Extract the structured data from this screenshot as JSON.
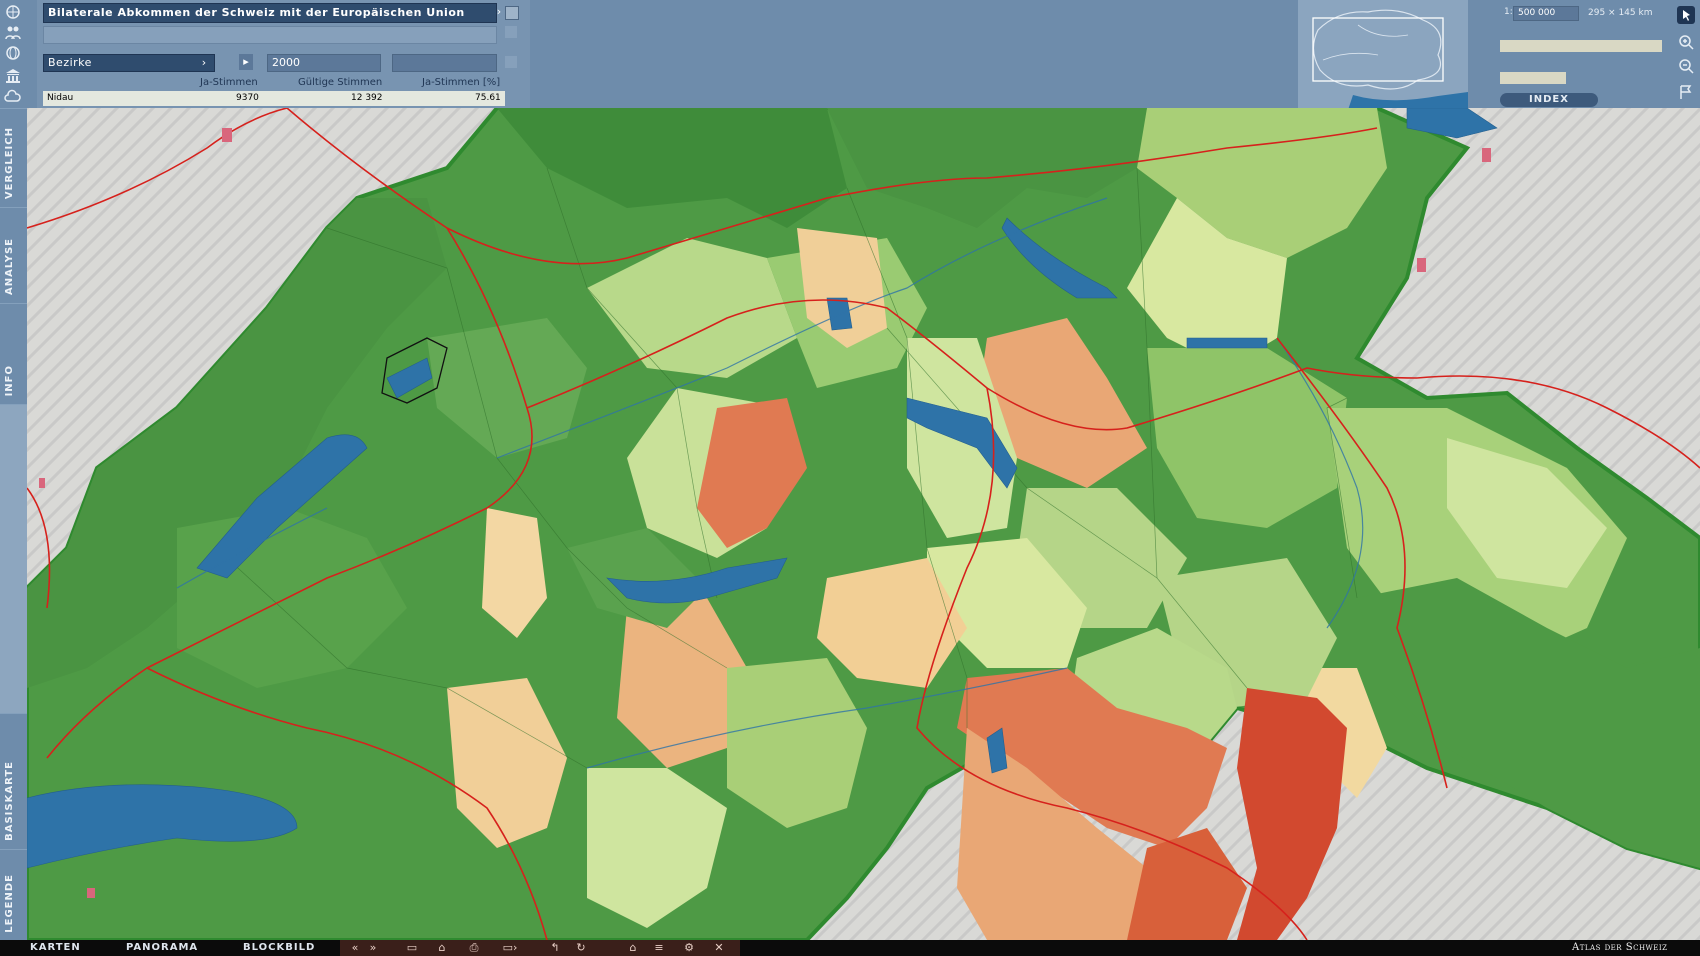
{
  "header": {
    "map_title": "Bilaterale Abkommen der Schweiz mit der Europäischen Union",
    "level_select": "Bezirke",
    "year": "2000",
    "columns": [
      "Ja-Stimmen",
      "Gültige Stimmen",
      "Ja-Stimmen [%]"
    ],
    "row": {
      "name": "Nidau",
      "ja": "9370",
      "gueltig": "12 392",
      "prozent": "75.61"
    }
  },
  "scale": {
    "prefix": "1:",
    "value": "500 000",
    "extent": "295 × 145 km"
  },
  "index_label": "INDEX",
  "side_tabs": [
    "VERGLEICH",
    "ANALYSE",
    "INFO",
    "BASISKARTE",
    "LEGENDE"
  ],
  "bottom_tabs": [
    "KARTEN",
    "PANORAMA",
    "BLOCKBILD"
  ],
  "brand": "Atlas der Schweiz",
  "colors": {
    "ui_blue": "#6e8cab",
    "lake": "#2e73a8",
    "road": "#d6211c",
    "border": "#3aa43a",
    "high_yes": "#3f8c3a",
    "low_yes": "#d9613b"
  },
  "icons": [
    "world-icon",
    "people-icon",
    "globe-icon",
    "building-icon",
    "cloud-icon",
    "play-icon",
    "zoom-in-icon",
    "zoom-out-icon",
    "flag-icon"
  ]
}
